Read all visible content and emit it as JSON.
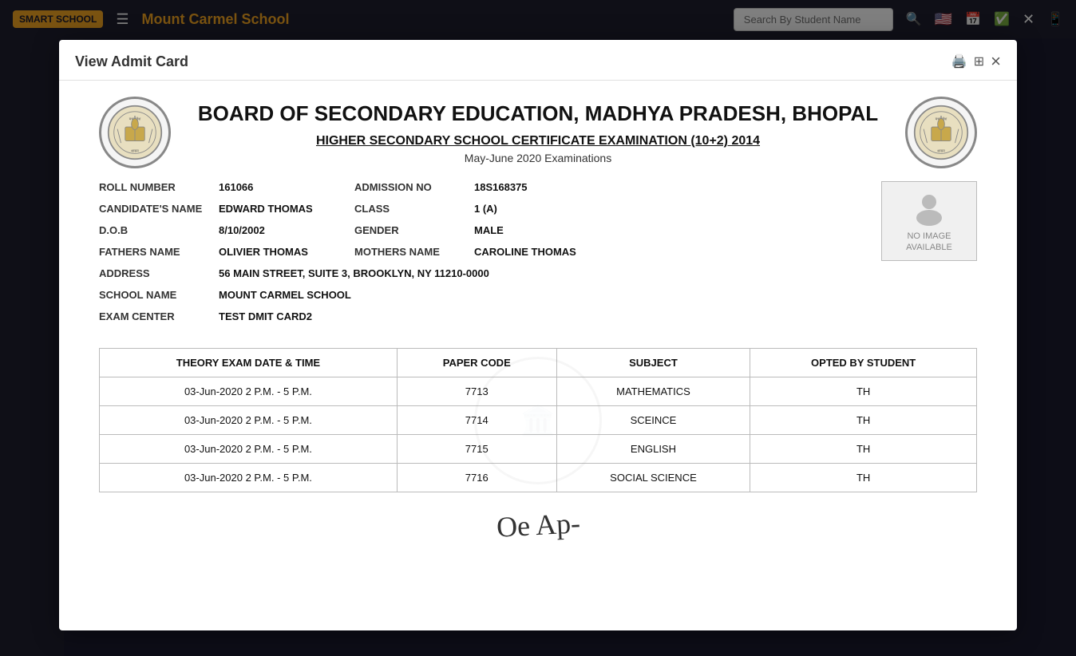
{
  "app": {
    "logo": "SMART SCHOOL",
    "title": "Mount Carmel School"
  },
  "modal": {
    "title": "View Admit Card",
    "close_label": "×"
  },
  "admit_card": {
    "board_title": "BOARD OF SECONDARY EDUCATION, MADHYA PRADESH, BHOPAL",
    "exam_title": "HIGHER SECONDARY SCHOOL CERTIFICATE EXAMINATION (10+2) 2014",
    "exam_session": "May-June 2020 Examinations",
    "fields": {
      "roll_number_label": "ROLL NUMBER",
      "roll_number": "161066",
      "admission_no_label": "ADMISSION NO",
      "admission_no": "18S168375",
      "candidates_name_label": "CANDIDATE'S NAME",
      "candidates_name": "EDWARD THOMAS",
      "class_label": "CLASS",
      "class_value": "1 (A)",
      "dob_label": "D.O.B",
      "dob": "8/10/2002",
      "gender_label": "GENDER",
      "gender": "MALE",
      "fathers_name_label": "FATHERS NAME",
      "fathers_name": "OLIVIER THOMAS",
      "mothers_name_label": "MOTHERS NAME",
      "mothers_name": "CAROLINE THOMAS",
      "address_label": "ADDRESS",
      "address": "56 MAIN STREET, SUITE 3, BROOKLYN, NY 11210-0000",
      "school_name_label": "SCHOOL NAME",
      "school_name": "MOUNT CARMEL SCHOOL",
      "exam_center_label": "EXAM CENTER",
      "exam_center": "TEST DMIT CARD2"
    },
    "photo": {
      "no_image_text": "NO IMAGE\nAVAILABLE"
    },
    "table": {
      "headers": [
        "THEORY EXAM DATE & TIME",
        "PAPER CODE",
        "SUBJECT",
        "OPTED BY STUDENT"
      ],
      "rows": [
        {
          "date": "03-Jun-2020 2 P.M. - 5 P.M.",
          "code": "7713",
          "subject": "MATHEMATICS",
          "opted": "TH"
        },
        {
          "date": "03-Jun-2020 2 P.M. - 5 P.M.",
          "code": "7714",
          "subject": "SCEINCE",
          "opted": "TH"
        },
        {
          "date": "03-Jun-2020 2 P.M. - 5 P.M.",
          "code": "7715",
          "subject": "ENGLISH",
          "opted": "TH"
        },
        {
          "date": "03-Jun-2020 2 P.M. - 5 P.M.",
          "code": "7716",
          "subject": "SOCIAL SCIENCE",
          "opted": "TH"
        }
      ]
    },
    "signature_text": "Oe Ap-"
  }
}
